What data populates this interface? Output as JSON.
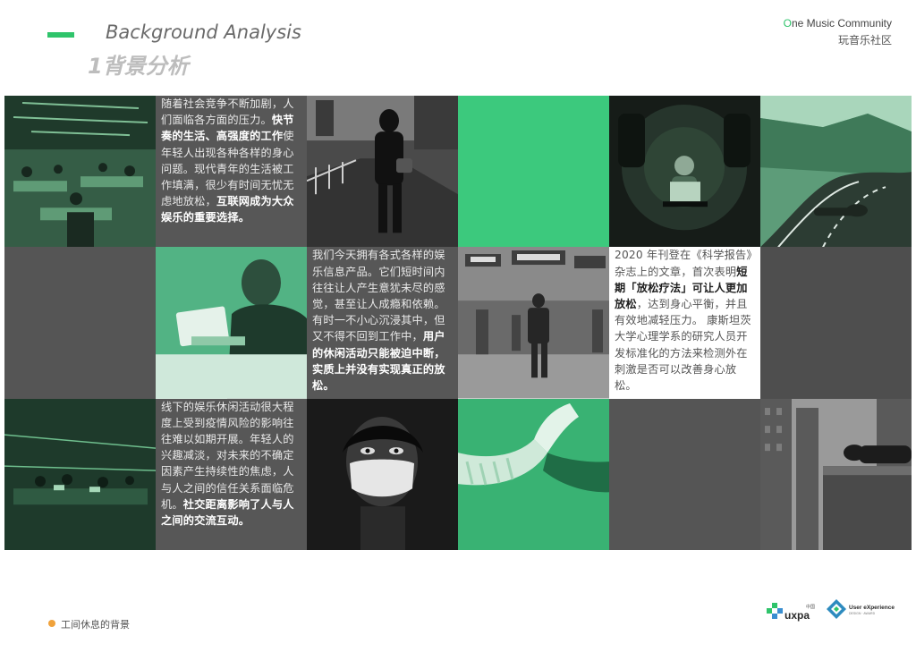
{
  "header": {
    "title_en": "Background Analysis",
    "title_cn": "1背景分析",
    "brand_first_letter": "O",
    "brand_en_rest": "ne Music Community",
    "brand_cn": "玩音乐社区"
  },
  "texts": {
    "block1": {
      "p1": "随着社会竞争不断加剧，人们面临各方面的压力。",
      "b1": "快节奏的生活、高强度的工作",
      "p2": "使年轻人出现各种各样的身心问题。现代青年的生活被工作填满，很少有时间无忧无虑地放松，",
      "b2": "互联网成为大众娱乐的重要选择。"
    },
    "block2": {
      "p1": "我们今天拥有各式各样的娱乐信息产品。它们短时间内往往让人产生意犹未尽的感觉，甚至让人成瘾和依赖。有时一不小心沉浸其中，但又不得不回到工作中，",
      "b1": "用户的休闲活动只能被迫中断，实质上并没有实现真正的放松。"
    },
    "block3": {
      "p1": "2020 年刊登在《科学报告》杂志上的文章，首次表明",
      "b1": "短期「放松疗法」可让人更加放松",
      "p2": "，达到身心平衡，并且有效地减轻压力。 康斯坦茨大学心理学系的研究人员开发标准化的方法来检测外在刺激是否可以改善身心放松。"
    },
    "block4": {
      "p1": "线下的娱乐休闲活动很大程度上受到疫情风险的影响往往难以如期开展。年轻人的兴趣减淡，对未来的不确定因素产生持续性的焦虑，人与人之间的信任关系面临危机。",
      "b1": "社交距离影响了人与人之间的交流互动。"
    }
  },
  "footer": {
    "label": "工间休息的背景"
  },
  "logos": {
    "uxpa_text": "uxpa",
    "uxpa_china": "中国",
    "ux_title": "User eXperience",
    "ux_sub": "DESIGN · AWARD"
  },
  "colors": {
    "accent_green": "#2fc46b",
    "tile_green": "#3cc97d",
    "text_gray": "#575757",
    "footer_dot": "#f0a23b"
  }
}
